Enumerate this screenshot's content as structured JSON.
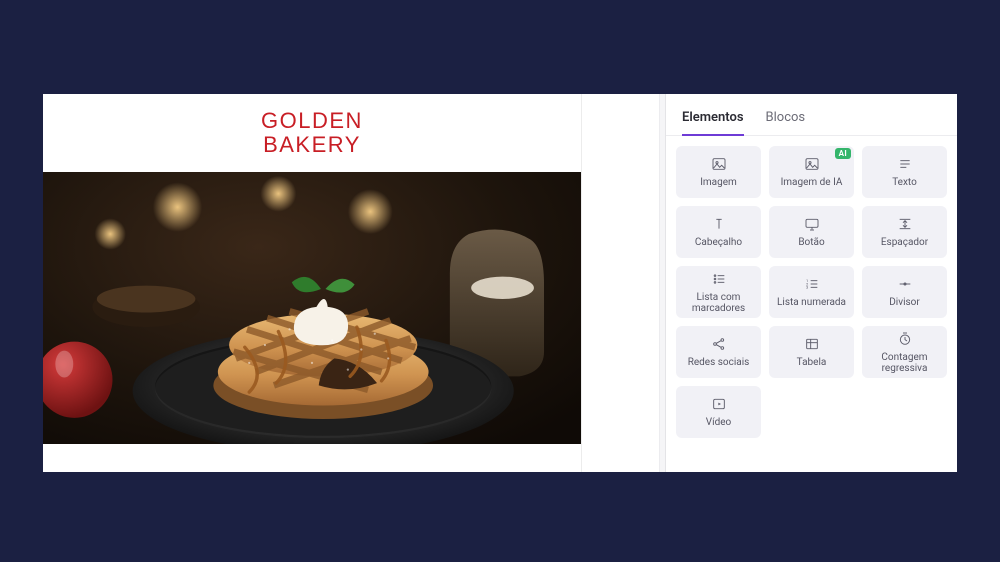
{
  "colors": {
    "page_bg": "#1b2042",
    "accent": "#6e3bd6",
    "brand_red": "#c81e25",
    "badge_green": "#34b56b"
  },
  "canvas": {
    "logo_line1": "GOLDEN",
    "logo_line2": "BAKERY",
    "hero_alt": "Plated waffle pastry with cream, mint garnish, caramel drizzle, powdered sugar; red apple and milk pitcher in warm bokeh background"
  },
  "panel": {
    "tabs": [
      {
        "id": "elements",
        "label": "Elementos",
        "active": true
      },
      {
        "id": "blocks",
        "label": "Blocos",
        "active": false
      }
    ],
    "badge_ai": "AI",
    "tiles": [
      {
        "id": "image",
        "label": "Imagem",
        "icon": "image-icon"
      },
      {
        "id": "image-ai",
        "label": "Imagem de IA",
        "icon": "image-icon",
        "badge": "AI"
      },
      {
        "id": "text",
        "label": "Texto",
        "icon": "text-icon"
      },
      {
        "id": "heading",
        "label": "Cabeçalho",
        "icon": "heading-icon"
      },
      {
        "id": "button",
        "label": "Botão",
        "icon": "button-icon"
      },
      {
        "id": "spacer",
        "label": "Espaçador",
        "icon": "spacer-icon"
      },
      {
        "id": "ul",
        "label": "Lista com marcadores",
        "icon": "ul-icon"
      },
      {
        "id": "ol",
        "label": "Lista numerada",
        "icon": "ol-icon"
      },
      {
        "id": "divider",
        "label": "Divisor",
        "icon": "divider-icon"
      },
      {
        "id": "social",
        "label": "Redes sociais",
        "icon": "share-icon"
      },
      {
        "id": "table",
        "label": "Tabela",
        "icon": "table-icon"
      },
      {
        "id": "countdown",
        "label": "Contagem regressiva",
        "icon": "clock-icon"
      },
      {
        "id": "video",
        "label": "Vídeo",
        "icon": "video-icon"
      }
    ]
  }
}
